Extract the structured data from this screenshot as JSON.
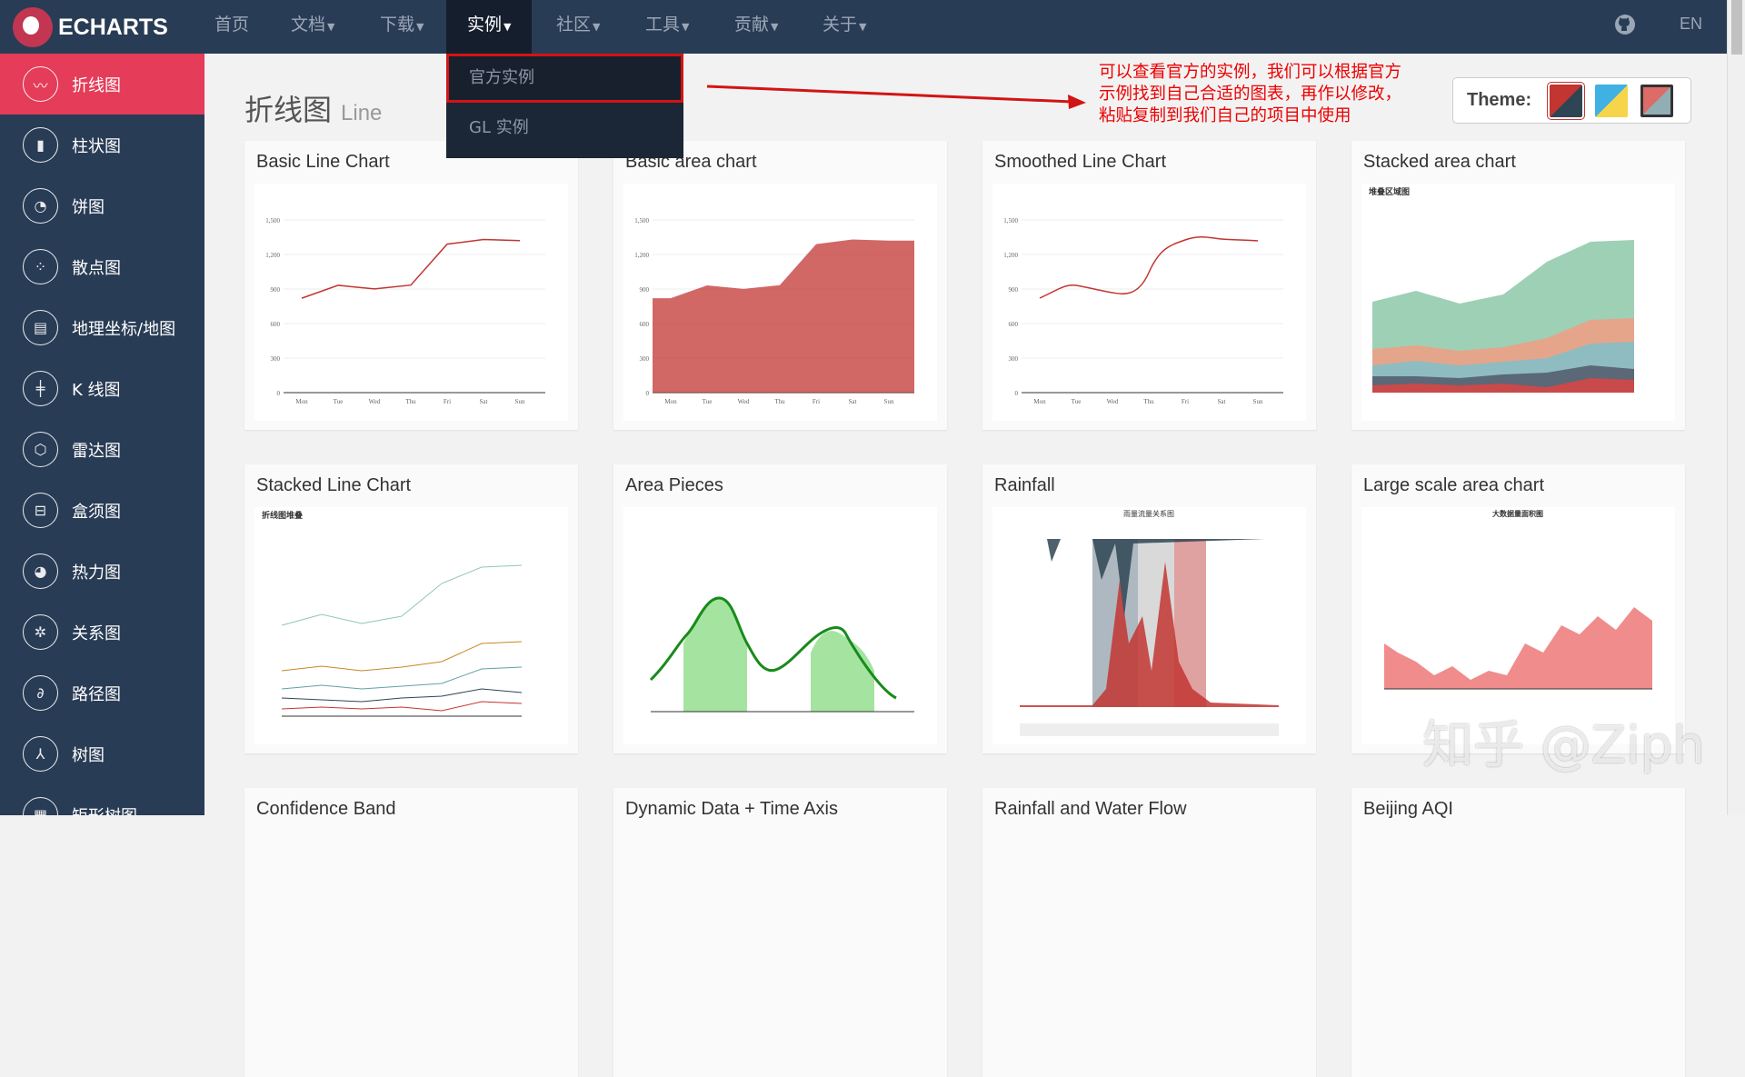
{
  "nav": {
    "brand": "ECHARTS",
    "items": [
      {
        "label": "首页",
        "caret": false
      },
      {
        "label": "文档",
        "caret": true
      },
      {
        "label": "下载",
        "caret": true
      },
      {
        "label": "实例",
        "caret": true,
        "active": true
      },
      {
        "label": "社区",
        "caret": true
      },
      {
        "label": "工具",
        "caret": true
      },
      {
        "label": "贡献",
        "caret": true
      },
      {
        "label": "关于",
        "caret": true
      }
    ],
    "github_icon": "github-icon",
    "lang": "EN"
  },
  "dropdown": {
    "items": [
      "官方实例",
      "GL 实例"
    ],
    "highlighted": "官方实例"
  },
  "sidebar": {
    "items": [
      {
        "label": "折线图",
        "icon": "line-chart-icon",
        "glyph": "〰",
        "active": true
      },
      {
        "label": "柱状图",
        "icon": "bar-chart-icon",
        "glyph": "▮"
      },
      {
        "label": "饼图",
        "icon": "pie-chart-icon",
        "glyph": "◔"
      },
      {
        "label": "散点图",
        "icon": "scatter-icon",
        "glyph": "⁘"
      },
      {
        "label": "地理坐标/地图",
        "icon": "map-icon",
        "glyph": "▤"
      },
      {
        "label": "K 线图",
        "icon": "candlestick-icon",
        "glyph": "╪"
      },
      {
        "label": "雷达图",
        "icon": "radar-icon",
        "glyph": "⬡"
      },
      {
        "label": "盒须图",
        "icon": "boxplot-icon",
        "glyph": "⊟"
      },
      {
        "label": "热力图",
        "icon": "heatmap-icon",
        "glyph": "◕"
      },
      {
        "label": "关系图",
        "icon": "graph-icon",
        "glyph": "✲"
      },
      {
        "label": "路径图",
        "icon": "lines-icon",
        "glyph": "∂"
      },
      {
        "label": "树图",
        "icon": "tree-icon",
        "glyph": "⅄"
      },
      {
        "label": "矩形树图",
        "icon": "treemap-icon",
        "glyph": "▦"
      }
    ]
  },
  "page": {
    "title": "折线图",
    "subtitle": "Line"
  },
  "annotation": {
    "text": "可以查看官方的实例，我们可以根据官方示例找到自己合适的图表，再作以修改，粘贴复制到我们自己的项目中使用",
    "color": "#e00000"
  },
  "theme": {
    "label": "Theme:",
    "options": [
      "#c23531/#2f4554",
      "#3fb1e3/#f6d54a",
      "#e01f54/#5e4ea5"
    ]
  },
  "cards": [
    {
      "title": "Basic Line Chart"
    },
    {
      "title": "Basic area chart"
    },
    {
      "title": "Smoothed Line Chart"
    },
    {
      "title": "Stacked area chart"
    },
    {
      "title": "Stacked Line Chart"
    },
    {
      "title": "Area Pieces"
    },
    {
      "title": "Rainfall"
    },
    {
      "title": "Large scale area chart"
    },
    {
      "title": "Confidence Band"
    },
    {
      "title": "Dynamic Data + Time Axis"
    },
    {
      "title": "Rainfall and Water Flow"
    },
    {
      "title": "Beijing AQI"
    }
  ],
  "thumbs": {
    "days": [
      "Mon",
      "Tue",
      "Wed",
      "Thu",
      "Fri",
      "Sat",
      "Sun"
    ],
    "yticks": [
      "0",
      "300",
      "600",
      "900",
      "1,200",
      "1,500"
    ],
    "stacked_title": "堆叠区域图",
    "stacked_line_title": "折线图堆叠",
    "rain_title": "雨量流量关系图",
    "large_title": "大数据量面积图"
  },
  "watermark": "知乎 @Ziph",
  "colors": {
    "nav": "#293c55",
    "active": "#e43c59",
    "line": "#c23531"
  }
}
